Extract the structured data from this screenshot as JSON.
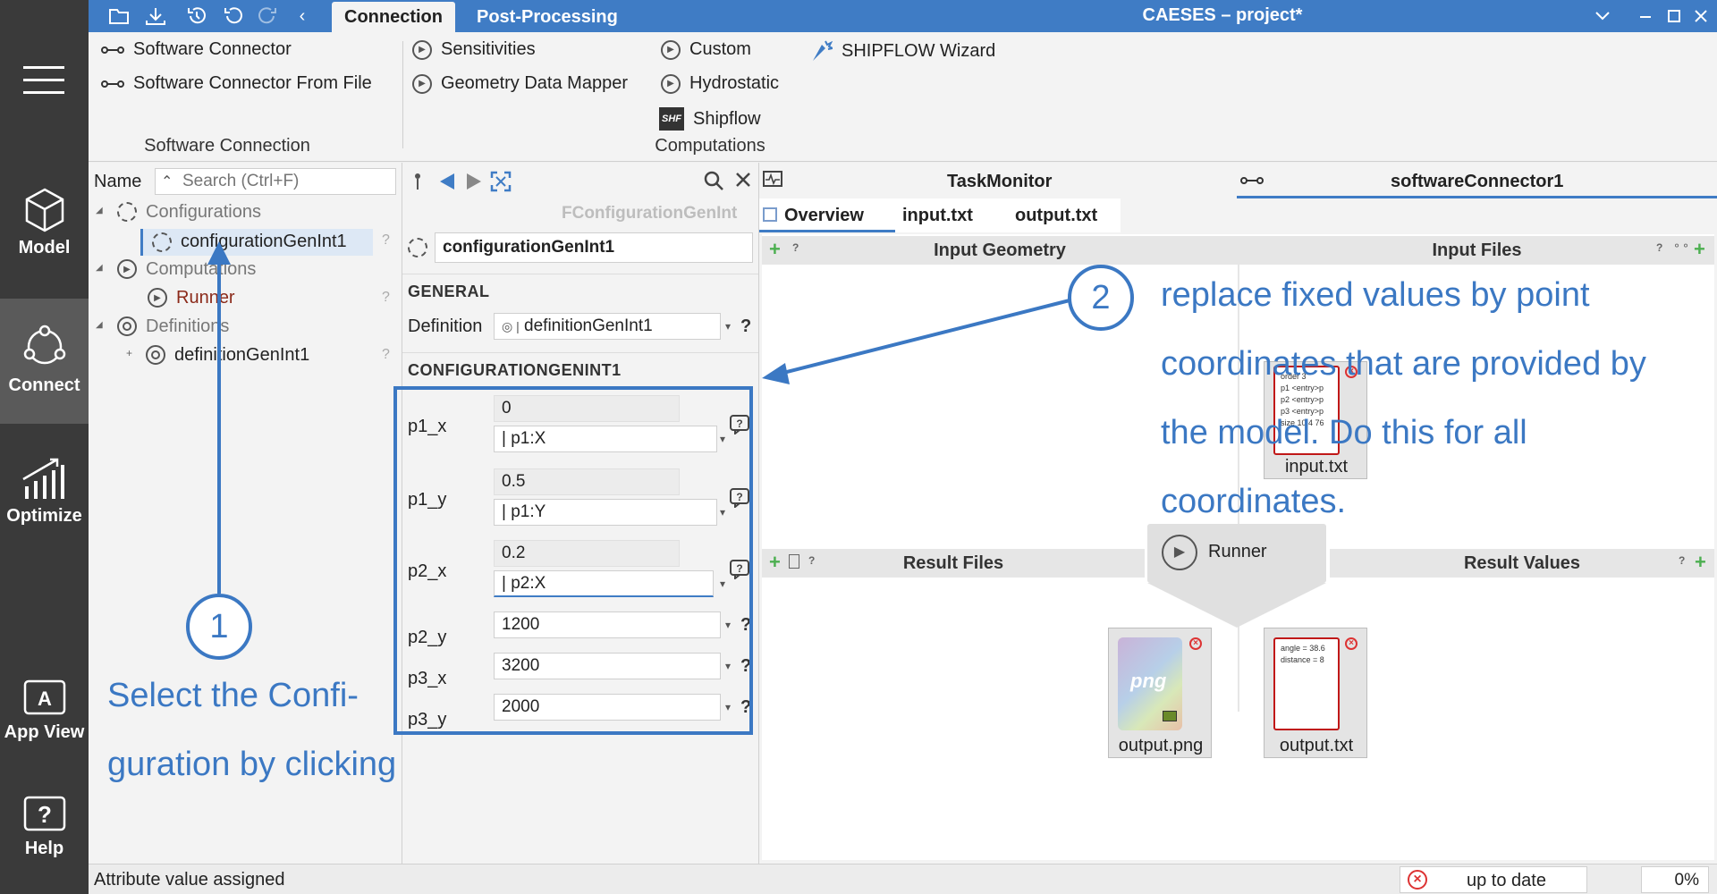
{
  "titlebar": {
    "tabs": [
      "Connection",
      "Post-Processing"
    ],
    "app_title": "CAESES – project*"
  },
  "rail": {
    "items": [
      "Model",
      "Connect",
      "Optimize",
      "App View",
      "Help"
    ]
  },
  "ribbon": {
    "software_connector": "Software Connector",
    "software_connector_from_file": "Software Connector From File",
    "group_software_connection": "Software Connection",
    "sensitivities": "Sensitivities",
    "geometry_data_mapper": "Geometry Data Mapper",
    "custom": "Custom",
    "hydrostatic": "Hydrostatic",
    "shipflow": "Shipflow",
    "shf_badge": "SHF",
    "shipflow_wizard": "SHIPFLOW Wizard",
    "group_computations": "Computations"
  },
  "tree": {
    "name_label": "Name",
    "search_placeholder": "Search (Ctrl+F)",
    "configurations": "Configurations",
    "configuration_item": "configurationGenInt1",
    "computations": "Computations",
    "runner": "Runner",
    "definitions": "Definitions",
    "definition_item": "definitionGenInt1",
    "help": "?"
  },
  "editor": {
    "type_label": "FConfigurationGenInt",
    "name_value": "configurationGenInt1",
    "general_header": "GENERAL",
    "definition_label": "Definition",
    "definition_value": "definitionGenInt1",
    "config_header": "CONFIGURATIONGENINT1",
    "help": "?",
    "params": [
      {
        "label": "p1_x",
        "fixed": "0",
        "expr": "p1:X"
      },
      {
        "label": "p1_y",
        "fixed": "0.5",
        "expr": "p1:Y"
      },
      {
        "label": "p2_x",
        "fixed": "0.2",
        "expr": "p2:X"
      }
    ],
    "simple_params": [
      {
        "label": "p2_y",
        "value": "1200"
      },
      {
        "label": "p3_x",
        "value": "3200"
      },
      {
        "label": "p3_y",
        "value": "2000"
      }
    ]
  },
  "task": {
    "taskmonitor": "TaskMonitor",
    "connector_tab": "softwareConnector1",
    "subtabs": [
      "Overview",
      "input.txt",
      "output.txt"
    ],
    "input_geometry": "Input Geometry",
    "input_files": "Input Files",
    "result_files": "Result Files",
    "result_values": "Result Values",
    "runner": "Runner",
    "input_file": {
      "name": "input.txt",
      "lines": [
        "order 3",
        "p1 <entry>p",
        "p2 <entry>p",
        "p3 <entry>p",
        "size 10.4 76"
      ]
    },
    "output_png": {
      "name": "output.png",
      "badge": "png"
    },
    "output_txt": {
      "name": "output.txt",
      "lines": [
        "angle = 38.6",
        "distance = 8"
      ]
    }
  },
  "annotations": {
    "num1": "1",
    "num2": "2",
    "text1_line1": "Select the Confi-",
    "text1_line2": "guration by clicking",
    "text2_line1": "replace fixed values by point",
    "text2_line2": "coordinates that are provided by",
    "text2_line3": "the model. Do this for all",
    "text2_line4": "coordinates."
  },
  "status": {
    "message": "Attribute value assigned",
    "state": "up to date",
    "progress": "0%"
  },
  "colors": {
    "accent": "#3f7cc5",
    "annotation": "#3b78c3",
    "rail": "#3a3a3a",
    "error": "#d33333"
  }
}
